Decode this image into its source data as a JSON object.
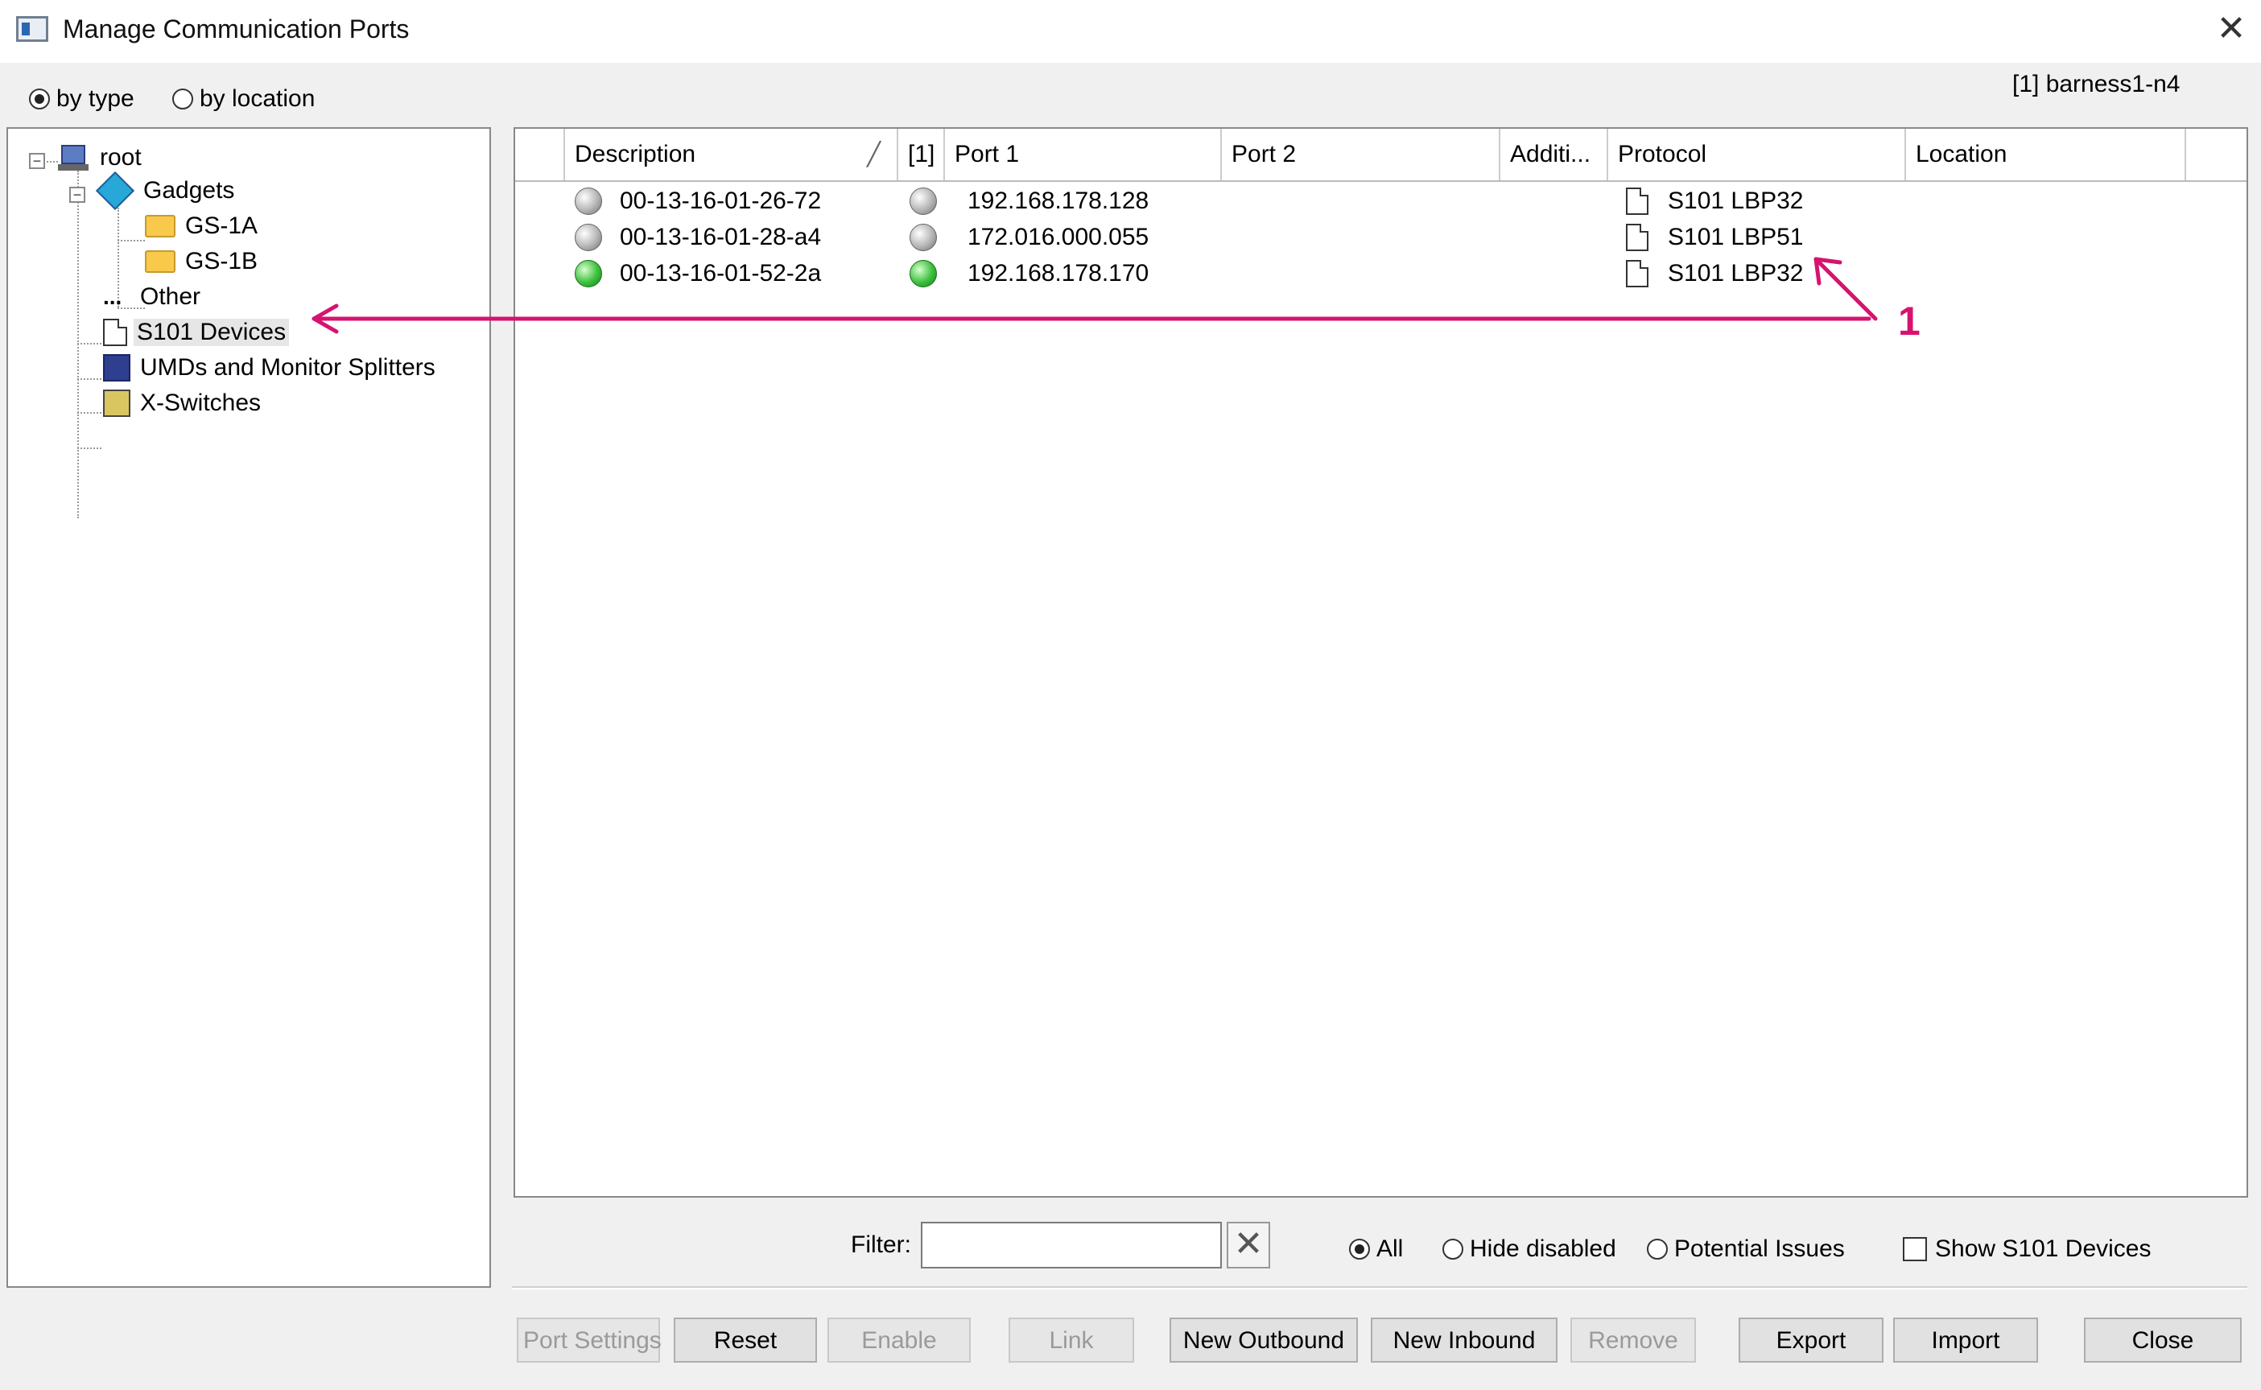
{
  "window": {
    "title": "Manage Communication Ports",
    "close_glyph": "✕"
  },
  "view_mode": {
    "by_type": {
      "label": "by type",
      "selected": true
    },
    "by_location": {
      "label": "by location",
      "selected": false
    }
  },
  "location_label": "[1] barness1-n4",
  "tree": {
    "root": "root",
    "gadgets": "Gadgets",
    "gs1a": "GS-1A",
    "gs1b": "GS-1B",
    "other": "Other",
    "s101": "S101 Devices",
    "umds": "UMDs and Monitor Splitters",
    "xswitches": "X-Switches",
    "toggle_minus": "−"
  },
  "grid": {
    "columns": {
      "description": "Description",
      "sort_glyph": "╱",
      "index": "[1]",
      "port1": "Port 1",
      "port2": "Port 2",
      "additional": "Additi...",
      "protocol": "Protocol",
      "location": "Location"
    },
    "rows": [
      {
        "status": "gray",
        "description": "00-13-16-01-26-72",
        "port1_status": "gray",
        "port1": "192.168.178.128",
        "port2": "",
        "protocol": "S101 LBP32"
      },
      {
        "status": "gray",
        "description": "00-13-16-01-28-a4",
        "port1_status": "gray",
        "port1": "172.016.000.055",
        "port2": "",
        "protocol": "S101 LBP51"
      },
      {
        "status": "green",
        "description": "00-13-16-01-52-2a",
        "port1_status": "green",
        "port1": "192.168.178.170",
        "port2": "",
        "protocol": "S101 LBP32"
      }
    ]
  },
  "filter": {
    "label": "Filter:",
    "value": "",
    "clear_glyph": "✕",
    "options": {
      "all": {
        "label": "All",
        "selected": true
      },
      "hide_disabled": {
        "label": "Hide disabled",
        "selected": false
      },
      "potential_issues": {
        "label": "Potential Issues",
        "selected": false
      }
    },
    "show_s101": {
      "label": "Show S101 Devices",
      "checked": false
    }
  },
  "buttons": {
    "port_settings": "Port Settings",
    "reset": "Reset",
    "enable": "Enable",
    "link": "Link",
    "new_outbound": "New Outbound",
    "new_inbound": "New Inbound",
    "remove": "Remove",
    "export": "Export",
    "import": "Import",
    "close": "Close"
  },
  "annotation": {
    "number": "1",
    "color": "#d6136f"
  },
  "colors": {
    "status_gray": "#b5b5b5",
    "status_green": "#3dbf3d",
    "disabled_text": "#9a9a9a"
  }
}
